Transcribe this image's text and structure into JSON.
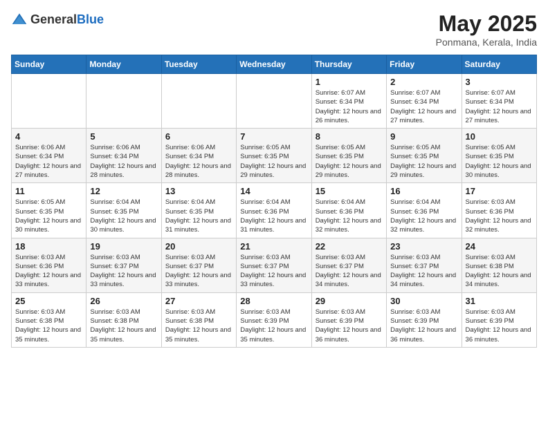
{
  "header": {
    "logo_general": "General",
    "logo_blue": "Blue",
    "month_title": "May 2025",
    "location": "Ponmana, Kerala, India"
  },
  "days_of_week": [
    "Sunday",
    "Monday",
    "Tuesday",
    "Wednesday",
    "Thursday",
    "Friday",
    "Saturday"
  ],
  "weeks": [
    [
      {
        "day": "",
        "info": ""
      },
      {
        "day": "",
        "info": ""
      },
      {
        "day": "",
        "info": ""
      },
      {
        "day": "",
        "info": ""
      },
      {
        "day": "1",
        "info": "Sunrise: 6:07 AM\nSunset: 6:34 PM\nDaylight: 12 hours and 26 minutes."
      },
      {
        "day": "2",
        "info": "Sunrise: 6:07 AM\nSunset: 6:34 PM\nDaylight: 12 hours and 27 minutes."
      },
      {
        "day": "3",
        "info": "Sunrise: 6:07 AM\nSunset: 6:34 PM\nDaylight: 12 hours and 27 minutes."
      }
    ],
    [
      {
        "day": "4",
        "info": "Sunrise: 6:06 AM\nSunset: 6:34 PM\nDaylight: 12 hours and 27 minutes."
      },
      {
        "day": "5",
        "info": "Sunrise: 6:06 AM\nSunset: 6:34 PM\nDaylight: 12 hours and 28 minutes."
      },
      {
        "day": "6",
        "info": "Sunrise: 6:06 AM\nSunset: 6:34 PM\nDaylight: 12 hours and 28 minutes."
      },
      {
        "day": "7",
        "info": "Sunrise: 6:05 AM\nSunset: 6:35 PM\nDaylight: 12 hours and 29 minutes."
      },
      {
        "day": "8",
        "info": "Sunrise: 6:05 AM\nSunset: 6:35 PM\nDaylight: 12 hours and 29 minutes."
      },
      {
        "day": "9",
        "info": "Sunrise: 6:05 AM\nSunset: 6:35 PM\nDaylight: 12 hours and 29 minutes."
      },
      {
        "day": "10",
        "info": "Sunrise: 6:05 AM\nSunset: 6:35 PM\nDaylight: 12 hours and 30 minutes."
      }
    ],
    [
      {
        "day": "11",
        "info": "Sunrise: 6:05 AM\nSunset: 6:35 PM\nDaylight: 12 hours and 30 minutes."
      },
      {
        "day": "12",
        "info": "Sunrise: 6:04 AM\nSunset: 6:35 PM\nDaylight: 12 hours and 30 minutes."
      },
      {
        "day": "13",
        "info": "Sunrise: 6:04 AM\nSunset: 6:35 PM\nDaylight: 12 hours and 31 minutes."
      },
      {
        "day": "14",
        "info": "Sunrise: 6:04 AM\nSunset: 6:36 PM\nDaylight: 12 hours and 31 minutes."
      },
      {
        "day": "15",
        "info": "Sunrise: 6:04 AM\nSunset: 6:36 PM\nDaylight: 12 hours and 32 minutes."
      },
      {
        "day": "16",
        "info": "Sunrise: 6:04 AM\nSunset: 6:36 PM\nDaylight: 12 hours and 32 minutes."
      },
      {
        "day": "17",
        "info": "Sunrise: 6:03 AM\nSunset: 6:36 PM\nDaylight: 12 hours and 32 minutes."
      }
    ],
    [
      {
        "day": "18",
        "info": "Sunrise: 6:03 AM\nSunset: 6:36 PM\nDaylight: 12 hours and 33 minutes."
      },
      {
        "day": "19",
        "info": "Sunrise: 6:03 AM\nSunset: 6:37 PM\nDaylight: 12 hours and 33 minutes."
      },
      {
        "day": "20",
        "info": "Sunrise: 6:03 AM\nSunset: 6:37 PM\nDaylight: 12 hours and 33 minutes."
      },
      {
        "day": "21",
        "info": "Sunrise: 6:03 AM\nSunset: 6:37 PM\nDaylight: 12 hours and 33 minutes."
      },
      {
        "day": "22",
        "info": "Sunrise: 6:03 AM\nSunset: 6:37 PM\nDaylight: 12 hours and 34 minutes."
      },
      {
        "day": "23",
        "info": "Sunrise: 6:03 AM\nSunset: 6:37 PM\nDaylight: 12 hours and 34 minutes."
      },
      {
        "day": "24",
        "info": "Sunrise: 6:03 AM\nSunset: 6:38 PM\nDaylight: 12 hours and 34 minutes."
      }
    ],
    [
      {
        "day": "25",
        "info": "Sunrise: 6:03 AM\nSunset: 6:38 PM\nDaylight: 12 hours and 35 minutes."
      },
      {
        "day": "26",
        "info": "Sunrise: 6:03 AM\nSunset: 6:38 PM\nDaylight: 12 hours and 35 minutes."
      },
      {
        "day": "27",
        "info": "Sunrise: 6:03 AM\nSunset: 6:38 PM\nDaylight: 12 hours and 35 minutes."
      },
      {
        "day": "28",
        "info": "Sunrise: 6:03 AM\nSunset: 6:39 PM\nDaylight: 12 hours and 35 minutes."
      },
      {
        "day": "29",
        "info": "Sunrise: 6:03 AM\nSunset: 6:39 PM\nDaylight: 12 hours and 36 minutes."
      },
      {
        "day": "30",
        "info": "Sunrise: 6:03 AM\nSunset: 6:39 PM\nDaylight: 12 hours and 36 minutes."
      },
      {
        "day": "31",
        "info": "Sunrise: 6:03 AM\nSunset: 6:39 PM\nDaylight: 12 hours and 36 minutes."
      }
    ]
  ]
}
